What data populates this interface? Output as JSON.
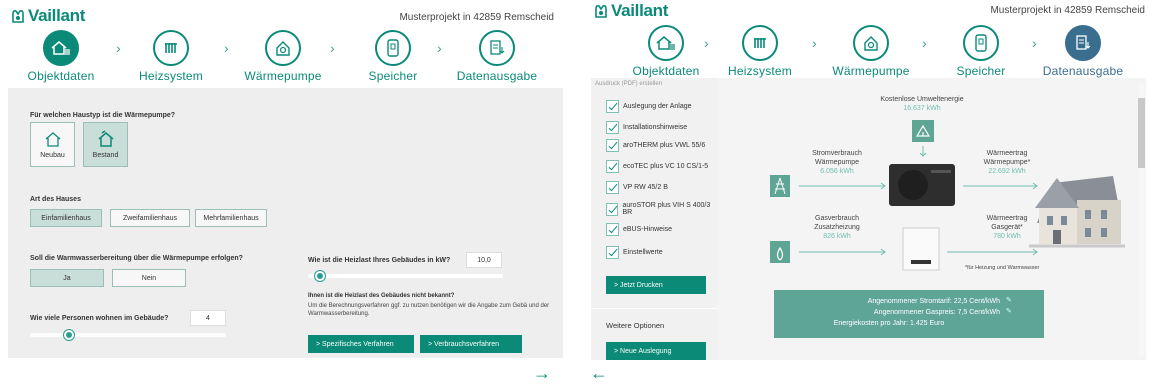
{
  "brand": "Vaillant",
  "project": "Musterprojekt in 42859 Remscheid",
  "colors": {
    "accent": "#0b8a78",
    "done": "#3a6e8f",
    "panel": "#eeeeee"
  },
  "steps": [
    {
      "label": "Objektdaten",
      "icon": "house-icon"
    },
    {
      "label": "Heizsystem",
      "icon": "radiator-icon"
    },
    {
      "label": "Wärmepumpe",
      "icon": "heatpump-icon"
    },
    {
      "label": "Speicher",
      "icon": "storage-icon"
    },
    {
      "label": "Datenausgabe",
      "icon": "document-download-icon"
    }
  ],
  "left": {
    "q_house": "Für welchen Haustyp ist die Wärmepumpe?",
    "house_new": "Neubau",
    "house_existing": "Bestand",
    "q_art": "Art des Hauses",
    "art_options": [
      "Einfamilienhaus",
      "Zweifamilienhaus",
      "Mehrfamilienhaus"
    ],
    "q_water": "Soll die Warmwasserbereitung über die Wärmepumpe erfolgen?",
    "yes": "Ja",
    "no": "Nein",
    "q_persons": "Wie viele Personen wohnen im Gebäude?",
    "persons": "4",
    "persons_slider": 0.2,
    "q_load": "Wie ist die Heizlast Ihres Gebäudes in kW?",
    "load": "10,0",
    "load_slider": 0.06,
    "hint_title": "Ihnen ist die Heizlast des Gebäudes nicht bekannt?",
    "hint_text": "Um die Berechnungsverfahren ggf. zu nutzen benötigen wir die Angabe zum Gebä und der Warmwasserbereitung.",
    "btn_specific": "> Spezifisches Verfahren",
    "btn_consumption": "> Verbrauchsverfahren"
  },
  "right": {
    "print_header": "Ausdruck (PDF) erstellen",
    "checks": [
      "Auslegung der Anlage",
      "Installationshinweise",
      "aroTHERM plus VWL 55/6",
      "ecoTEC plus VC 10 CS/1-5",
      "VP RW 45/2 B",
      "auroSTOR plus VIH S 400/3 BR",
      "eBUS-Hinweise",
      "Einstellwerte"
    ],
    "btn_print": "> Jetzt Drucken",
    "more_options": "Weitere Optionen",
    "btn_new": "> Neue Auslegung",
    "env_title": "Kostenlose Umweltenergie",
    "env_value": "16.637 kWh",
    "power_title1": "Stromverbrauch",
    "power_title2": "Wärmepumpe",
    "power_value": "6.056 kWh",
    "heat_title1": "Wärmeertrag",
    "heat_title2": "Wärmepumpe*",
    "heat_value": "22.692 kWh",
    "gas_title1": "Gasverbrauch",
    "gas_title2": "Zusatzheizung",
    "gas_value": "826 kWh",
    "gheat_title1": "Wärmeertrag",
    "gheat_title2": "Gasgerät*",
    "gheat_value": "780 kWh",
    "footnote": "*für Heizung und Warmwasser",
    "cost_rows": [
      {
        "label": "Angenommener Stromtarif:",
        "value": "22,5 Cent/kWh"
      },
      {
        "label": "Angenommener Gaspreis:",
        "value": "7,5 Cent/kWh"
      },
      {
        "label": "Energiekosten pro Jahr:",
        "value": "1.425 Euro"
      }
    ]
  }
}
